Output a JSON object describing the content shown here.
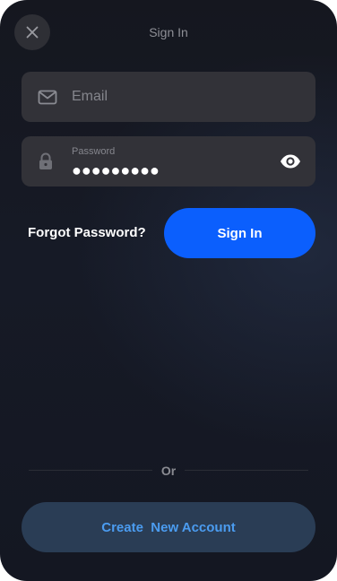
{
  "header": {
    "title": "Sign In",
    "close_icon": "close-icon"
  },
  "form": {
    "email": {
      "icon": "mail-icon",
      "placeholder": "Email",
      "value": ""
    },
    "password": {
      "icon": "lock-icon",
      "label": "Password",
      "value": "●●●●●●●●●",
      "toggle_icon": "eye-icon"
    }
  },
  "actions": {
    "forgot_label": "Forgot Password?",
    "signin_label": "Sign In"
  },
  "divider": {
    "label": "Or"
  },
  "footer": {
    "create_label": "Create  New Account"
  },
  "colors": {
    "background": "#15171f",
    "field": "#323238",
    "primary": "#0b5ffd",
    "secondary_button": "#2a3d55",
    "secondary_text": "#4b9cf0",
    "muted_text": "#85868d"
  }
}
